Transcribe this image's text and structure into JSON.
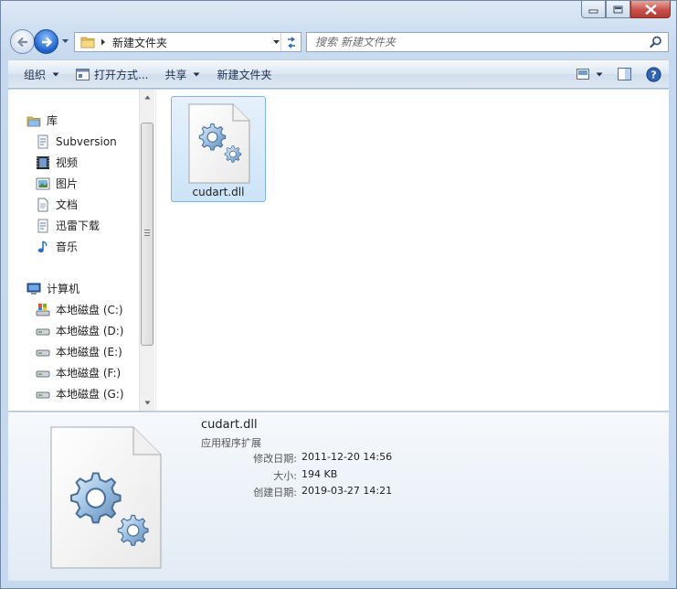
{
  "window": {
    "colors": {
      "selection_fill": "#cce4f8",
      "selection_border": "#7eb4ea",
      "accent": "#1c5fc6"
    }
  },
  "address_bar": {
    "current_folder": "新建文件夹"
  },
  "search": {
    "placeholder": "搜索 新建文件夹"
  },
  "toolbar": {
    "organize_label": "组织",
    "open_with_label": "打开方式...",
    "share_label": "共享",
    "new_folder_label": "新建文件夹"
  },
  "sidebar": {
    "library": {
      "label": "库",
      "items": [
        {
          "label": "Subversion",
          "icon": "subversion-icon"
        },
        {
          "label": "视频",
          "icon": "video-icon"
        },
        {
          "label": "图片",
          "icon": "pictures-icon"
        },
        {
          "label": "文档",
          "icon": "documents-icon"
        },
        {
          "label": "迅雷下载",
          "icon": "download-folder-icon"
        },
        {
          "label": "音乐",
          "icon": "music-icon"
        }
      ]
    },
    "computer": {
      "label": "计算机",
      "items": [
        {
          "label": "本地磁盘 (C:)",
          "icon": "system-drive-icon"
        },
        {
          "label": "本地磁盘 (D:)",
          "icon": "drive-icon"
        },
        {
          "label": "本地磁盘 (E:)",
          "icon": "drive-icon"
        },
        {
          "label": "本地磁盘 (F:)",
          "icon": "drive-icon"
        },
        {
          "label": "本地磁盘 (G:)",
          "icon": "drive-icon"
        }
      ]
    }
  },
  "files": [
    {
      "name": "cudart.dll",
      "icon": "dll-gear-file-icon"
    }
  ],
  "details": {
    "name": "cudart.dll",
    "type": "应用程序扩展",
    "modified_label": "修改日期:",
    "modified_value": "2011-12-20 14:56",
    "size_label": "大小:",
    "size_value": "194 KB",
    "created_label": "创建日期:",
    "created_value": "2019-03-27 14:21"
  }
}
